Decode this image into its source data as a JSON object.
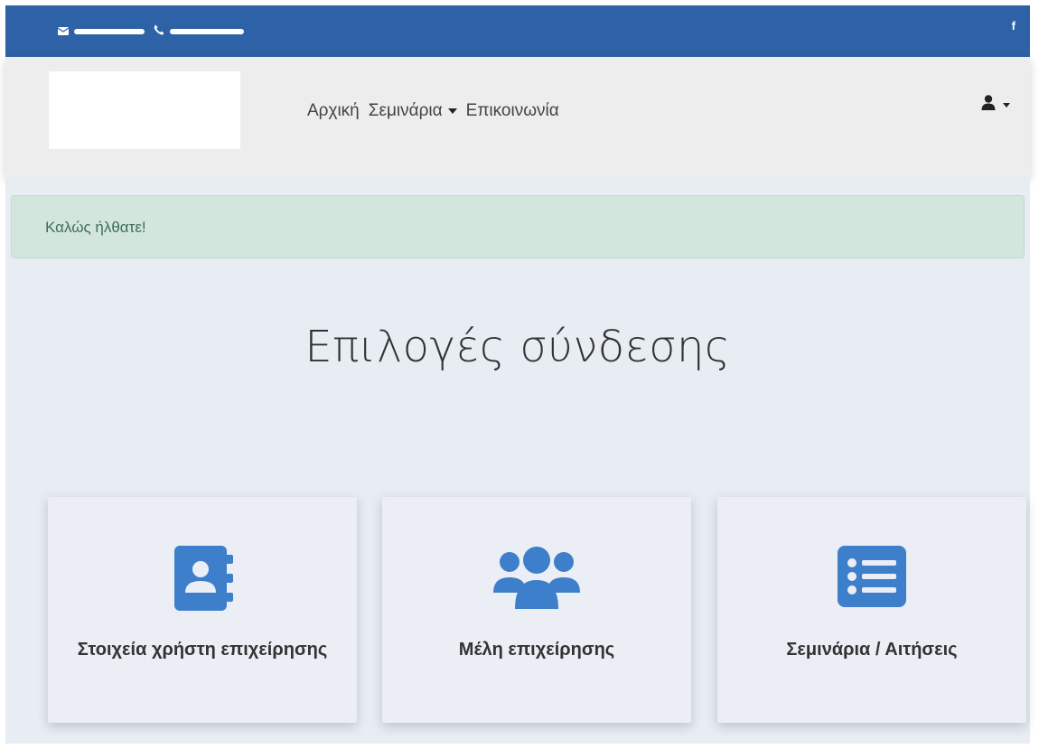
{
  "topbar": {
    "email_icon": "envelope-icon",
    "phone_icon": "phone-icon",
    "facebook_label": "f",
    "color": "#2e62a6"
  },
  "nav": {
    "items": [
      "Αρχική",
      "Σεμινάρια",
      "Επικοινωνία"
    ],
    "user_icon": "user-icon"
  },
  "alert": {
    "text": "Καλώς ήλθατε!"
  },
  "main": {
    "heading": "Επιλογές σύνδεσης",
    "cards": [
      {
        "label": "Στοιχεία χρήστη επιχείρησης",
        "icon": "address-book-icon"
      },
      {
        "label": "Μέλη επιχείρησης",
        "icon": "users-icon"
      },
      {
        "label": "Σεμινάρια / Αιτήσεις",
        "icon": "list-icon"
      }
    ],
    "icon_color": "#3e7fcb"
  }
}
